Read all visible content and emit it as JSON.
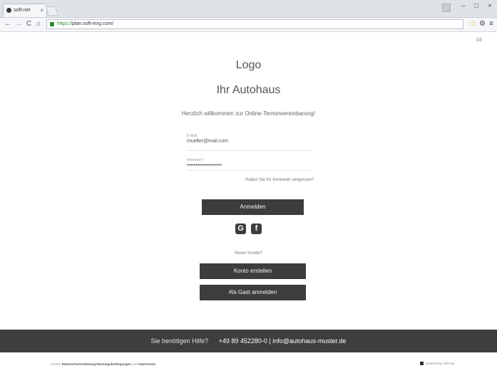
{
  "browser": {
    "tab_title": "soft-net",
    "tab_close": "×",
    "url_https": "https://",
    "url_rest": "plan.soft-mrg.com/",
    "minimize": "–",
    "maximize": "□",
    "close": "×"
  },
  "page": {
    "lang": "DE",
    "logo": "Logo",
    "org_name": "Ihr Autohaus",
    "welcome": "Herzlich willkommen zur Online-Terminvereinbarung!",
    "email_label": "E-Mail",
    "email_value": "mueller@mail.com",
    "password_label": "Kennwort *",
    "password_value": "••••••••••••••••••••",
    "forgot": "Haben Sie Ihr Kennwort vergessen?",
    "login_button": "Anmelden",
    "google_letter": "G",
    "facebook_letter": "f",
    "new_customer": "Neuer Kunde?",
    "register_button": "Konto erstellen",
    "guest_button": "Als Gast anmelden"
  },
  "footer": {
    "help": "Sie benötigen Hilfe?",
    "contact": "+49 89 452280-0 | info@autohaus-muster.de",
    "legal_prefix": "Unsere",
    "legal_privacy": "Datenschutzerklärung",
    "legal_sep": "/",
    "legal_terms": "Nutzungsbedingungen",
    "legal_and": "und",
    "legal_imprint": "Impressum",
    "powered": "powered by soft-nrg"
  }
}
